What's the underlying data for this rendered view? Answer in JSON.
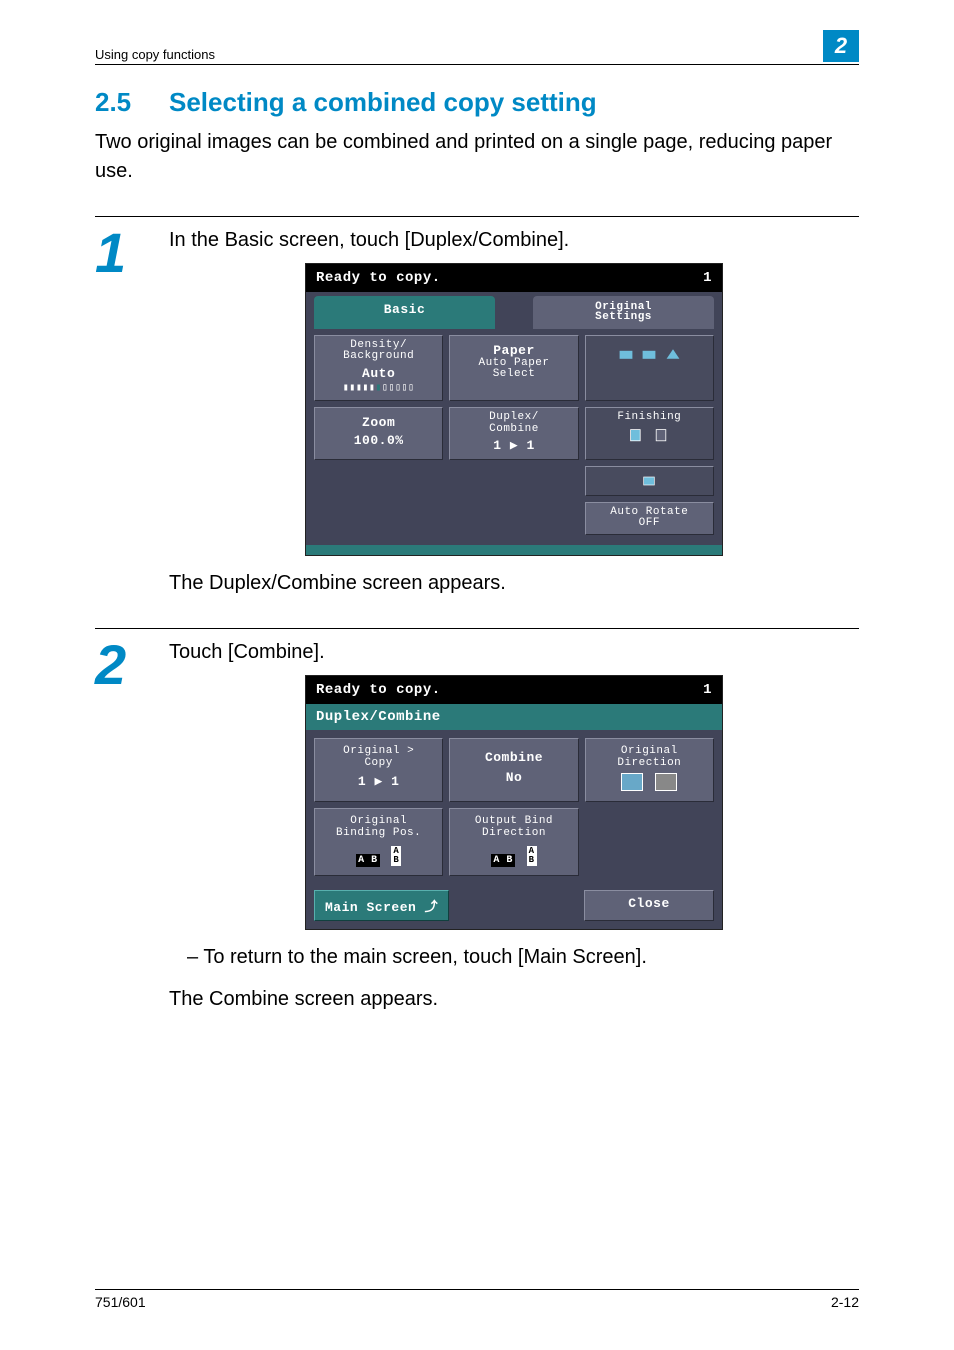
{
  "header": {
    "breadcrumb": "Using copy functions",
    "chapter": "2"
  },
  "section": {
    "number": "2.5",
    "title": "Selecting a combined copy setting"
  },
  "intro": "Two original images can be combined and printed on a single page, reducing paper use.",
  "step1": {
    "number": "1",
    "text": "In the Basic screen, touch [Duplex/Combine].",
    "after": "The Duplex/Combine screen appears.",
    "lcd": {
      "status": "Ready to copy.",
      "count": "1",
      "tab_active": "Basic",
      "tab_inactive": "Original\nSettings",
      "btns": {
        "density_t": "Density/\nBackground",
        "density_v": "Auto",
        "paper_t": "Paper",
        "paper_v": "Auto Paper\nSelect",
        "finishing_t": "Finishing",
        "zoom_t": "Zoom",
        "zoom_v": "100.0%",
        "duplex_t": "Duplex/\nCombine",
        "duplex_v": "1 ▶ 1",
        "rotate": "Auto Rotate\nOFF"
      }
    }
  },
  "step2": {
    "number": "2",
    "text": "Touch [Combine].",
    "bullet": "– To return to the main screen, touch [Main Screen].",
    "after": "The Combine screen appears.",
    "lcd": {
      "status": "Ready to copy.",
      "count": "1",
      "title": "Duplex/Combine",
      "btns": {
        "orig_copy_t": "Original >\nCopy",
        "orig_copy_v": "1 ▶ 1",
        "combine_t": "Combine",
        "combine_v": "No",
        "orig_dir_t": "Original\nDirection",
        "bind_pos_t": "Original\nBinding Pos.",
        "out_bind_t": "Output Bind\nDirection"
      },
      "footer": {
        "main": "Main Screen ⤴",
        "close": "Close"
      }
    }
  },
  "footer": {
    "left": "751/601",
    "right": "2-12"
  }
}
